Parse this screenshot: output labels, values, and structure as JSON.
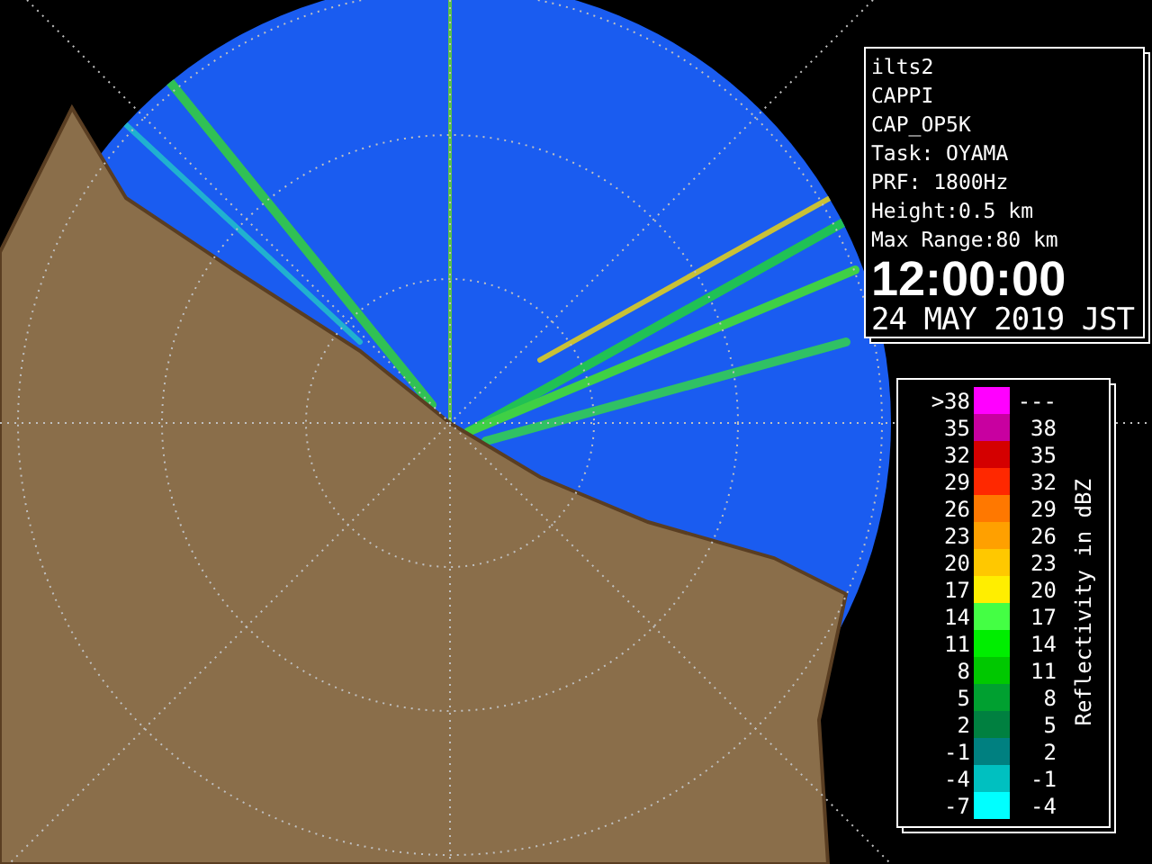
{
  "info": {
    "lines": [
      "ilts2",
      "CAPPI",
      "CAP_OP5K",
      "Task: OYAMA",
      "PRF: 1800Hz",
      "Height:0.5 km",
      "Max Range:80 km"
    ],
    "time": "12:00:00",
    "date": "24 MAY 2019 JST"
  },
  "legend": {
    "title": "Reflectivity in dBZ",
    "rows": [
      {
        "low": ">38",
        "high": "---",
        "color": "#ff00ff"
      },
      {
        "low": "35",
        "high": "38",
        "color": "#c800a0"
      },
      {
        "low": "32",
        "high": "35",
        "color": "#d40000"
      },
      {
        "low": "29",
        "high": "32",
        "color": "#ff2800"
      },
      {
        "low": "26",
        "high": "29",
        "color": "#ff7800"
      },
      {
        "low": "23",
        "high": "26",
        "color": "#ffa000"
      },
      {
        "low": "20",
        "high": "23",
        "color": "#ffc800"
      },
      {
        "low": "17",
        "high": "20",
        "color": "#ffee00"
      },
      {
        "low": "14",
        "high": "17",
        "color": "#44ff44"
      },
      {
        "low": "11",
        "high": "14",
        "color": "#00ee00"
      },
      {
        "low": "8",
        "high": "11",
        "color": "#00c800"
      },
      {
        "low": "5",
        "high": "8",
        "color": "#00a030"
      },
      {
        "low": "2",
        "high": "5",
        "color": "#008040"
      },
      {
        "low": "-1",
        "high": "2",
        "color": "#008080"
      },
      {
        "low": "-4",
        "high": "-1",
        "color": "#00c0c0"
      },
      {
        "low": "-7",
        "high": "-4",
        "color": "#00ffff"
      }
    ]
  }
}
